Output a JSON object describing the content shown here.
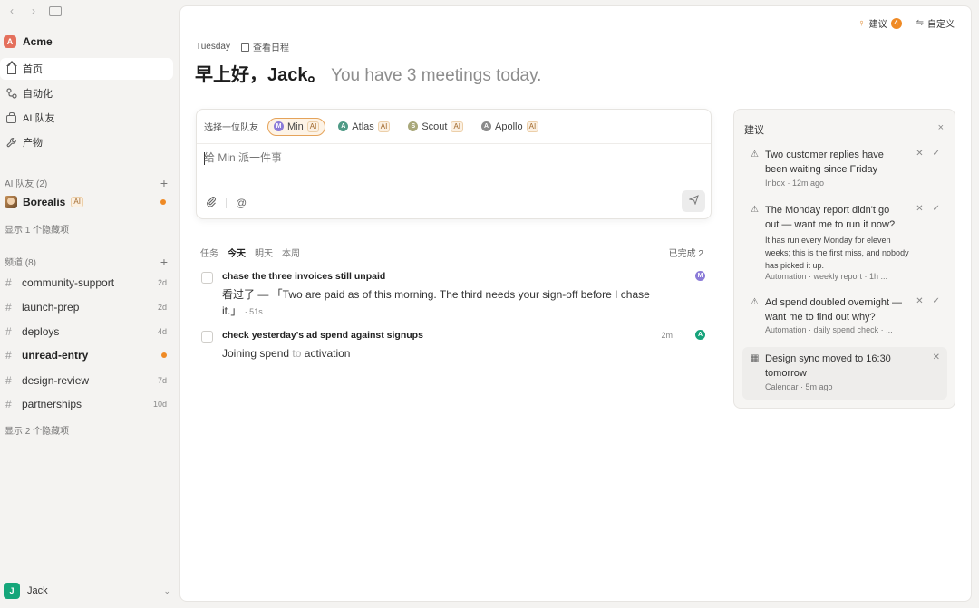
{
  "sidebar": {
    "workspace": {
      "initial": "A",
      "name": "Acme"
    },
    "nav": [
      {
        "label": "首页"
      },
      {
        "label": "自动化"
      },
      {
        "label": "AI 队友"
      },
      {
        "label": "产物"
      }
    ],
    "agents_section": {
      "title": "AI 队友 (2)",
      "plus": "+"
    },
    "agent": {
      "name": "Borealis",
      "badge": "AI"
    },
    "agents_hidden": "显示 1 个隐藏项",
    "channels_section": {
      "title": "频道 (8)",
      "plus": "+"
    },
    "channels": [
      {
        "name": "community-support",
        "age": "2d"
      },
      {
        "name": "launch-prep",
        "age": "2d"
      },
      {
        "name": "deploys",
        "age": "4d"
      },
      {
        "name": "unread-entry",
        "age": ""
      },
      {
        "name": "design-review",
        "age": "7d"
      },
      {
        "name": "partnerships",
        "age": "10d"
      }
    ],
    "channels_hidden": "显示 2 个隐藏项",
    "user": {
      "initial": "J",
      "name": "Jack"
    }
  },
  "header": {
    "suggest_label": "建议",
    "suggest_count": "4",
    "customize_label": "自定义",
    "day": "Tuesday",
    "schedule_link": "查看日程",
    "greeting": "早上好，Jack。",
    "subline": "You have 3 meetings today."
  },
  "composer": {
    "picker_label": "选择一位队友",
    "teammates": [
      {
        "initial": "M",
        "name": "Min",
        "badge": "AI",
        "color": "#8b7bd8"
      },
      {
        "initial": "A",
        "name": "Atlas",
        "badge": "AI",
        "color": "#4f9a86"
      },
      {
        "initial": "S",
        "name": "Scout",
        "badge": "AI",
        "color": "#a9a87a"
      },
      {
        "initial": "A",
        "name": "Apollo",
        "badge": "AI",
        "color": "#8a8a8a"
      }
    ],
    "placeholder": "给 Min 派一件事"
  },
  "tasks": {
    "tabs": [
      "任务",
      "今天",
      "明天",
      "本周"
    ],
    "done_label": "已完成 2",
    "items": [
      {
        "title": "chase the three invoices still unpaid",
        "body": "看过了 — 「Two are paid as of this morning. The third needs your sign-off before I chase it.」",
        "duration": "· 51s",
        "time": "",
        "assignee": "M",
        "assignee_color": "#8b7bd8"
      },
      {
        "title": "check yesterday's ad spend against signups",
        "body_a": "Joining spend",
        "body_b": "to",
        "body_c": "activation",
        "time": "2m",
        "assignee": "A",
        "assignee_color": "#16a37b"
      }
    ]
  },
  "suggestions": {
    "title": "建议",
    "close": "×",
    "items": [
      {
        "title": "Two customer replies have been waiting since Friday",
        "desc": "",
        "meta": "Inbox · 12m ago"
      },
      {
        "title": "The Monday report didn't go out — want me to run it now?",
        "desc": "It has run every Monday for eleven weeks; this is the first miss, and nobody has picked it up.",
        "meta": "Automation · weekly report · 1h ..."
      },
      {
        "title": "Ad spend doubled overnight — want me to find out why?",
        "desc": "",
        "meta": "Automation · daily spend check · ..."
      },
      {
        "title": "Design sync moved to 16:30 tomorrow",
        "desc": "",
        "meta": "Calendar · 5m ago"
      }
    ]
  }
}
